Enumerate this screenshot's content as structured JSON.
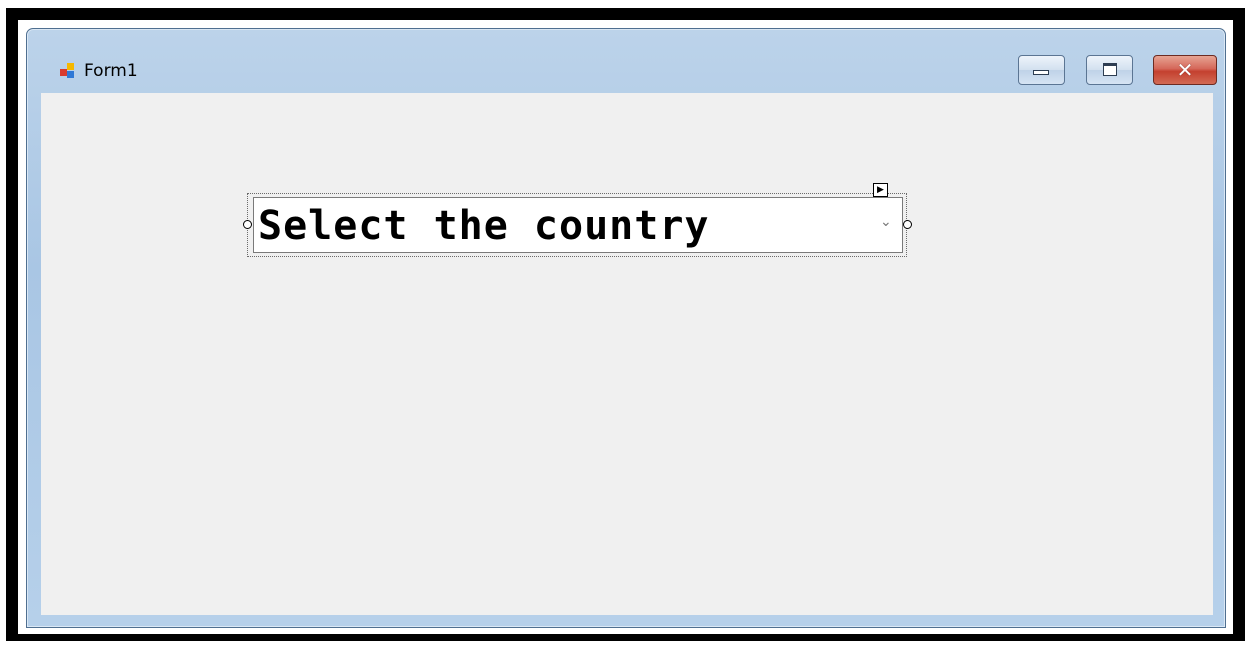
{
  "window": {
    "title": "Form1",
    "icon": "form-icon",
    "controls": {
      "minimize_icon": "minimize-icon",
      "maximize_icon": "maximize-icon",
      "close_icon": "close-icon",
      "close_glyph": "✕"
    }
  },
  "form": {
    "combobox": {
      "text": "Select the country",
      "arrow_glyph": "⌄",
      "arrow_icon": "chevron-down-icon"
    },
    "smart_tag_glyph": "▶"
  },
  "colors": {
    "client_background": "#f0f0f0",
    "close_button": "#c4402f",
    "title_bar": "#b6d0ea"
  }
}
